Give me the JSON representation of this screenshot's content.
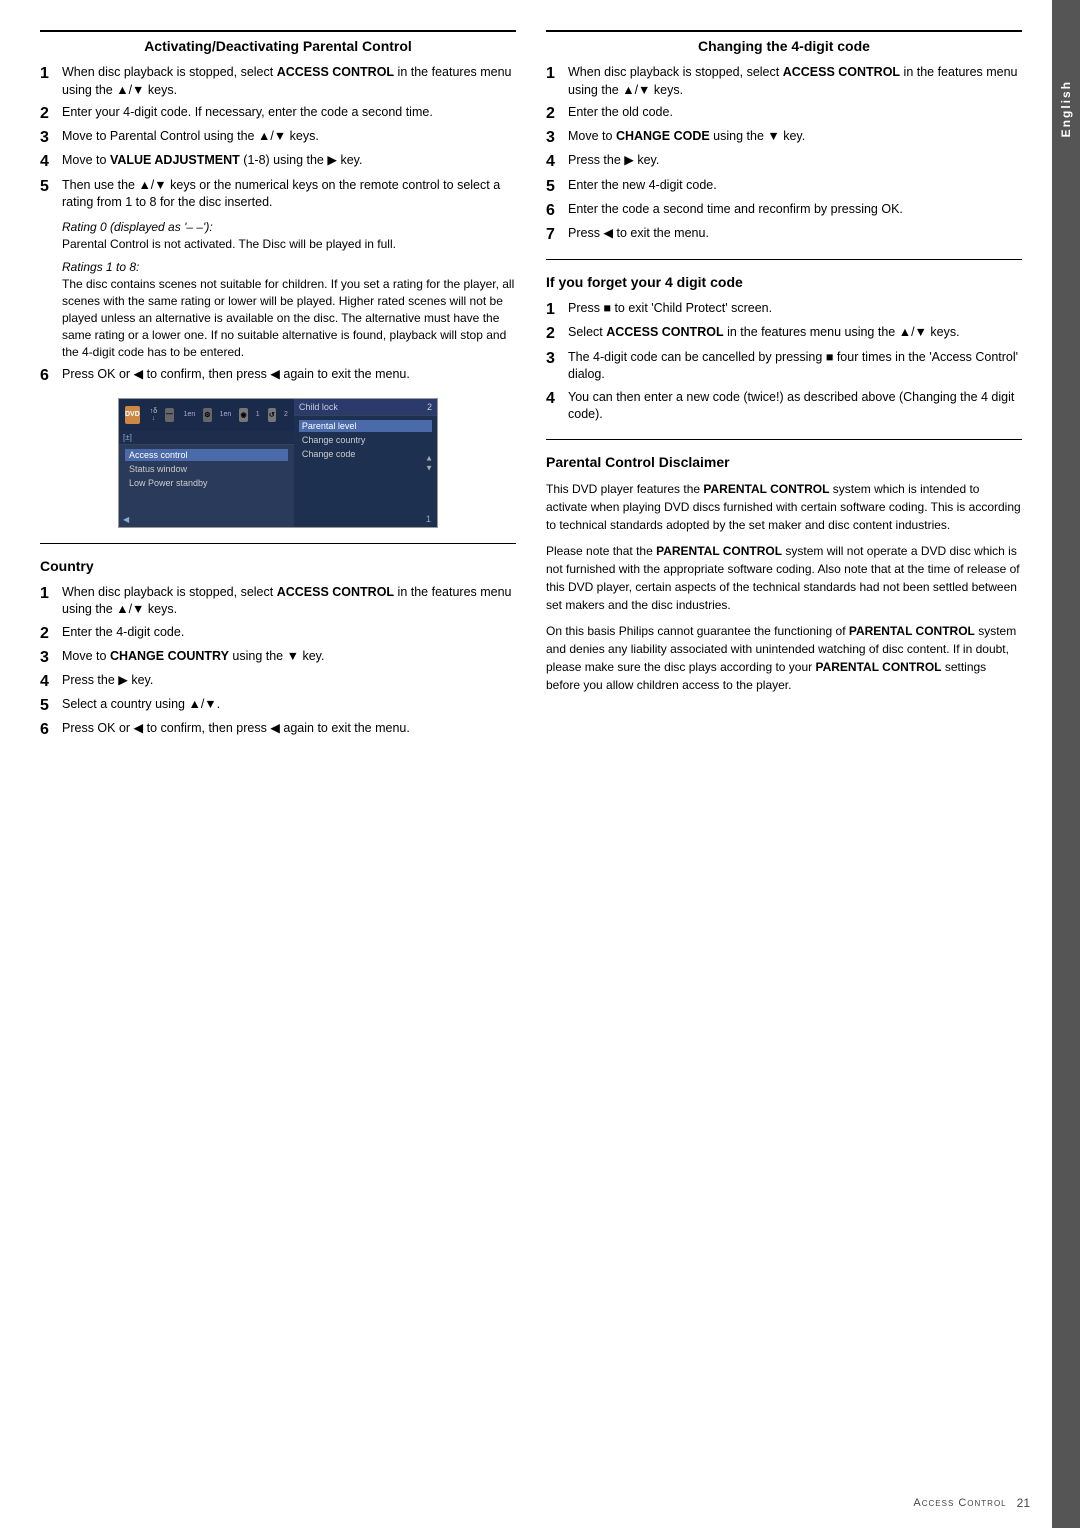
{
  "page": {
    "language_tab": "English",
    "footer_title": "Access Control",
    "footer_page": "21"
  },
  "left_column": {
    "section1": {
      "title": "Activating/Deactivating Parental Control",
      "steps": [
        {
          "num": "1",
          "text_parts": [
            {
              "type": "plain",
              "text": "When disc playback is stopped, select "
            },
            {
              "type": "bold",
              "text": "ACCESS CONTROL"
            },
            {
              "type": "plain",
              "text": " in the features menu using the ▲/▼ keys."
            }
          ],
          "html": "When disc playback is stopped, select <strong>ACCESS CONTROL</strong> in the features menu using the ▲/▼ keys."
        },
        {
          "num": "2",
          "html": "Enter your 4-digit code. If necessary, enter the code a second time."
        },
        {
          "num": "3",
          "html": "Move to Parental Control using the ▲/▼ keys."
        },
        {
          "num": "4",
          "html": "Move to <strong>VALUE ADJUSTMENT</strong> (1-8) using the ▶ key."
        },
        {
          "num": "5",
          "html": "Then use the ▲/▼ keys or the numerical keys on the remote control to select a rating from 1 to 8 for the disc inserted."
        }
      ],
      "sub_notes": [
        {
          "title": "Rating 0 (displayed as '– –'):",
          "body": "Parental Control is not activated. The Disc will be played in full."
        },
        {
          "title": "Ratings 1 to 8:",
          "body": "The disc contains scenes not suitable for children. If you set a rating for the player, all scenes with the same rating or lower will be played. Higher rated scenes will not be played unless an alternative is available on the disc. The alternative must have the same rating or a lower one. If no suitable alternative is found, playback will stop and the 4-digit code has to be entered."
        }
      ],
      "step6": {
        "num": "6",
        "html": "Press OK or ◀ to confirm, then press ◀ again to exit the menu."
      }
    },
    "section2": {
      "title": "Country",
      "steps": [
        {
          "num": "1",
          "html": "When disc playback is stopped, select <strong>ACCESS CONTROL</strong> in the features menu using the ▲/▼ keys."
        },
        {
          "num": "2",
          "html": "Enter the 4-digit code."
        },
        {
          "num": "3",
          "html": "Move to <strong>CHANGE COUNTRY</strong> using the ▼ key."
        },
        {
          "num": "4",
          "html": "Press the ▶ key."
        },
        {
          "num": "5",
          "html": "Select a country using ▲/▼."
        },
        {
          "num": "6",
          "html": "Press OK or ◀ to confirm, then press ◀ again to exit the menu."
        }
      ]
    }
  },
  "right_column": {
    "section1": {
      "title": "Changing the 4-digit code",
      "steps": [
        {
          "num": "1",
          "html": "When disc playback is stopped, select <strong>ACCESS CONTROL</strong> in the features menu using the ▲/▼ keys."
        },
        {
          "num": "2",
          "html": "Enter the old code."
        },
        {
          "num": "3",
          "html": "Move to <strong>CHANGE CODE</strong> using the ▼ key."
        },
        {
          "num": "4",
          "html": "Press the ▶ key."
        },
        {
          "num": "5",
          "html": "Enter the new 4-digit code."
        },
        {
          "num": "6",
          "html": "Enter the code a second time and reconfirm by pressing OK."
        },
        {
          "num": "7",
          "html": "Press ◀ to exit the menu."
        }
      ]
    },
    "section2": {
      "title": "If you forget your 4 digit code",
      "steps": [
        {
          "num": "1",
          "html": "Press ■ to exit 'Child Protect' screen."
        },
        {
          "num": "2",
          "html": "Select <strong>ACCESS CONTROL</strong> in the features menu using the ▲/▼ keys."
        },
        {
          "num": "3",
          "html": "The 4-digit code can be cancelled by pressing ■ four times in the 'Access Control' dialog."
        },
        {
          "num": "4",
          "html": "You can then enter a new code (twice!) as described above (Changing the 4 digit code)."
        }
      ]
    },
    "section3": {
      "title": "Parental Control Disclaimer",
      "paragraphs": [
        "This DVD player features the <strong>PARENTAL CONTROL</strong> system which is intended to activate when playing DVD discs furnished with certain software coding. This is according to technical standards adopted by the set maker and disc content industries.",
        "Please note that the <strong>PARENTAL CONTROL</strong> system will not operate a DVD disc which is not furnished with the appropriate software coding. Also note that at the time of release of this DVD player, certain aspects of the technical standards had not been settled between set makers and the disc industries.",
        "On this basis Philips cannot guarantee the functioning of <strong>PARENTAL CONTROL</strong> system and denies any liability associated with unintended watching of disc content. If in doubt, please make sure the disc plays according to your <strong>PARENTAL CONTROL</strong> settings before you allow children access to the player."
      ]
    }
  },
  "screenshot": {
    "menu_items_left": [
      "Access control",
      "Status window",
      "Low Power standby"
    ],
    "menu_items_right": [
      "Child lock",
      "Parental level",
      "Change country",
      "Change code"
    ],
    "icons": [
      "dvd",
      "clock",
      "settings",
      "disc",
      "arrow"
    ]
  }
}
